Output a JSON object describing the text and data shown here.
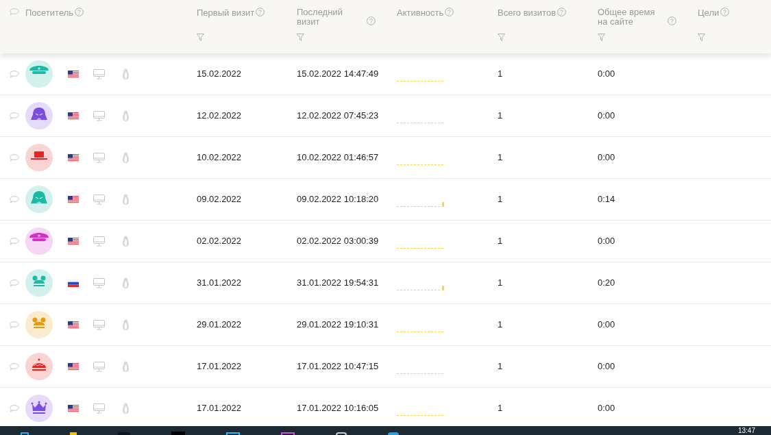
{
  "table": {
    "columns": [
      {
        "label": "Посетитель",
        "filter": false
      },
      {
        "label": "Первый визит",
        "filter": true
      },
      {
        "label": "Последний визит",
        "filter": true
      },
      {
        "label": "Активность",
        "filter": false
      },
      {
        "label": "Всего визитов",
        "filter": true
      },
      {
        "label": "Общее время на сайте",
        "filter": true
      },
      {
        "label": "Цели",
        "filter": true
      }
    ],
    "rows": [
      {
        "avatar": {
          "kind": "cap",
          "color": "#1cb9a4"
        },
        "flag": {
          "kind": "us"
        },
        "first_visit": "15.02.2022",
        "last_visit": "15.02.2022 14:47:49",
        "activity_spike": false,
        "visits": "1",
        "time": "0:00"
      },
      {
        "avatar": {
          "kind": "helmet",
          "color": "#7b4de0"
        },
        "flag": {
          "kind": "us"
        },
        "first_visit": "12.02.2022",
        "last_visit": "12.02.2022 07:45:23",
        "activity_spike": false,
        "visits": "1",
        "time": "0:00"
      },
      {
        "avatar": {
          "kind": "hat",
          "color": "#e52424"
        },
        "flag": {
          "kind": "us"
        },
        "first_visit": "10.02.2022",
        "last_visit": "10.02.2022 01:46:57",
        "activity_spike": false,
        "visits": "1",
        "time": "0:00"
      },
      {
        "avatar": {
          "kind": "helmet",
          "color": "#1cb9a4"
        },
        "flag": {
          "kind": "us"
        },
        "first_visit": "09.02.2022",
        "last_visit": "09.02.2022 10:18:20",
        "activity_spike": true,
        "visits": "1",
        "time": "0:14"
      },
      {
        "avatar": {
          "kind": "cap",
          "color": "#d62fc9"
        },
        "flag": {
          "kind": "us"
        },
        "first_visit": "02.02.2022",
        "last_visit": "02.02.2022 03:00:39",
        "activity_spike": false,
        "visits": "1",
        "time": "0:00"
      },
      {
        "avatar": {
          "kind": "ears",
          "color": "#1cb9a4"
        },
        "flag": {
          "kind": "ru"
        },
        "first_visit": "31.01.2022",
        "last_visit": "31.01.2022 19:54:31",
        "activity_spike": true,
        "visits": "1",
        "time": "0:20"
      },
      {
        "avatar": {
          "kind": "ears",
          "color": "#e69a10"
        },
        "flag": {
          "kind": "us"
        },
        "first_visit": "29.01.2022",
        "last_visit": "29.01.2022 19:10:31",
        "activity_spike": false,
        "visits": "1",
        "time": "0:00"
      },
      {
        "avatar": {
          "kind": "beanie",
          "color": "#e52424"
        },
        "flag": {
          "kind": "us"
        },
        "first_visit": "17.01.2022",
        "last_visit": "17.01.2022 10:47:15",
        "activity_spike": false,
        "visits": "1",
        "time": "0:00"
      },
      {
        "avatar": {
          "kind": "crown",
          "color": "#7b4de0"
        },
        "flag": {
          "kind": "us"
        },
        "first_visit": "17.01.2022",
        "last_visit": "17.01.2022 10:16:05",
        "activity_spike": false,
        "visits": "1",
        "time": "0:00"
      }
    ]
  },
  "taskbar": {
    "clock": "13:47"
  }
}
